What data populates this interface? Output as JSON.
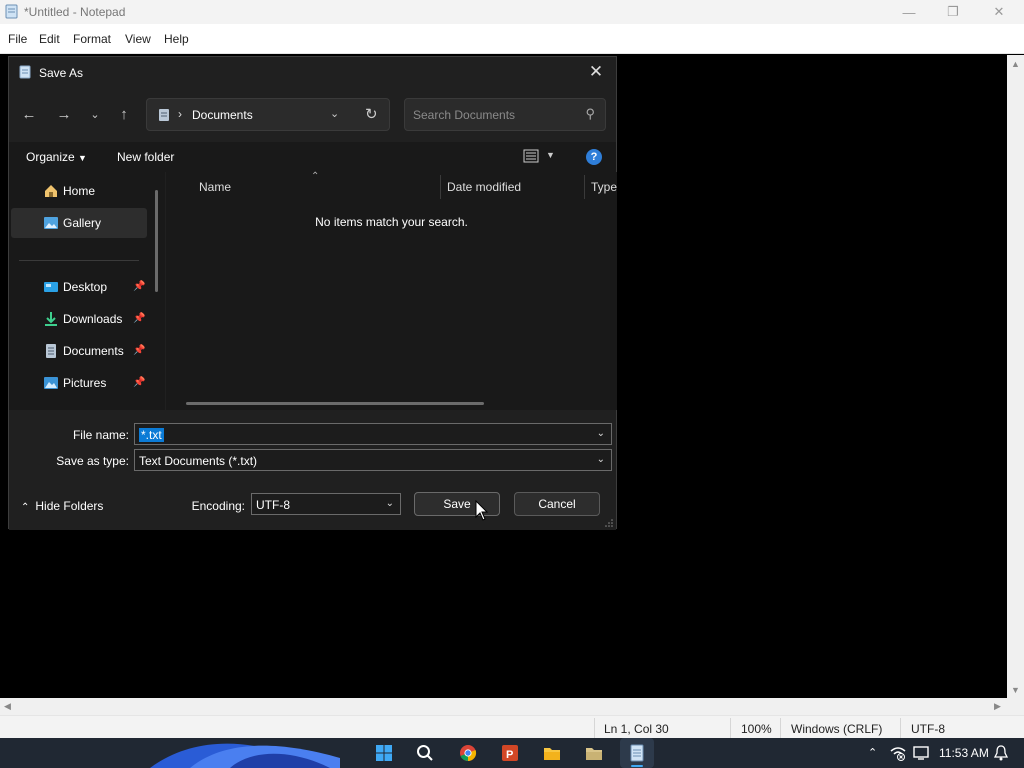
{
  "notepad": {
    "title": "*Untitled - Notepad",
    "menu": [
      "File",
      "Edit",
      "Format",
      "View",
      "Help"
    ],
    "status": {
      "position": "Ln 1, Col 30",
      "zoom": "100%",
      "line_ending": "Windows (CRLF)",
      "encoding": "UTF-8"
    }
  },
  "dialog": {
    "title": "Save As",
    "address": {
      "location": "Documents"
    },
    "search": {
      "placeholder": "Search Documents"
    },
    "toolbar": {
      "organize": "Organize",
      "new_folder": "New folder"
    },
    "nav_items": [
      {
        "label": "Home",
        "pinned": false,
        "icon": "home-icon"
      },
      {
        "label": "Gallery",
        "pinned": false,
        "icon": "gallery-icon",
        "selected": true
      },
      {
        "label": "Desktop",
        "pinned": true,
        "icon": "desktop-icon"
      },
      {
        "label": "Downloads",
        "pinned": true,
        "icon": "download-icon"
      },
      {
        "label": "Documents",
        "pinned": true,
        "icon": "document-icon"
      },
      {
        "label": "Pictures",
        "pinned": true,
        "icon": "pictures-icon"
      }
    ],
    "columns": [
      "Name",
      "Date modified",
      "Type"
    ],
    "empty_message": "No items match your search.",
    "file_name": {
      "label": "File name:",
      "value": "*.txt"
    },
    "save_type": {
      "label": "Save as type:",
      "value": "Text Documents (*.txt)"
    },
    "encoding": {
      "label": "Encoding:",
      "value": "UTF-8"
    },
    "hide_folders": "Hide Folders",
    "save_label": "Save",
    "cancel_label": "Cancel"
  },
  "taskbar": {
    "time": "11:53 AM",
    "apps": [
      "windows-start-icon",
      "search-icon",
      "chrome-icon",
      "powerpoint-icon",
      "file-explorer-icon",
      "folder-icon",
      "notepad-icon"
    ]
  },
  "colors": {
    "dialog_bg": "#202020",
    "pane_bg": "#191919",
    "accent": "#0b7bd6",
    "help": "#2f7ed8",
    "taskbar": "#202833"
  }
}
